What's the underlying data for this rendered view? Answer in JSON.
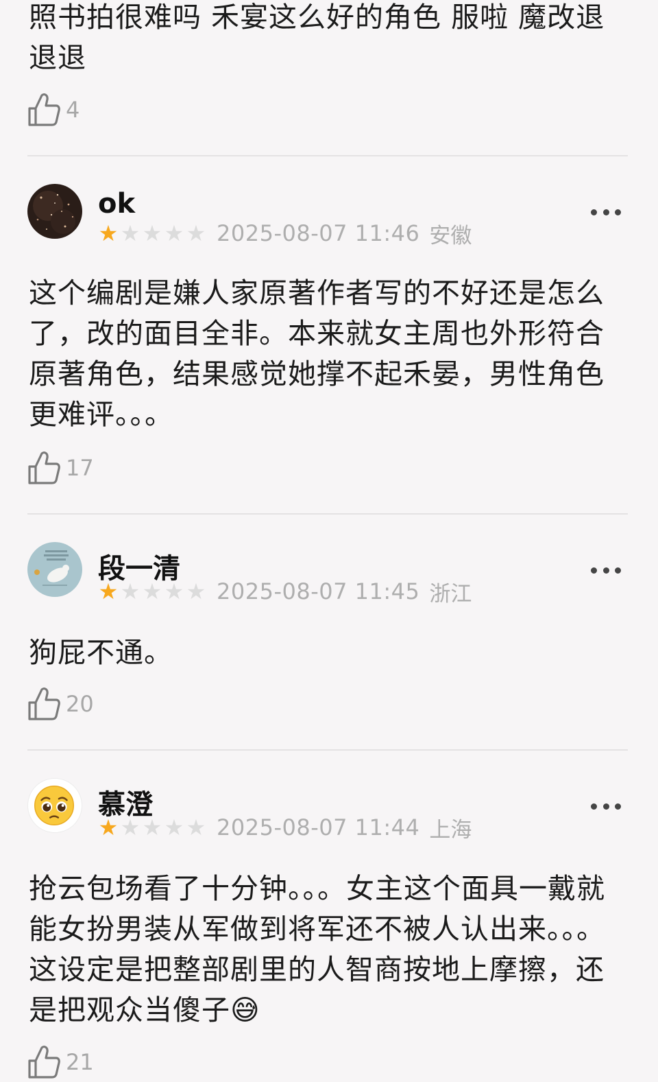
{
  "reviews": [
    {
      "text": "照书拍很难吗 禾宴这么好的角色 服啦 魔改退退退",
      "likes": "4"
    },
    {
      "user": "ok",
      "rating": 1,
      "date": "2025-08-07 11:46",
      "region": "安徽",
      "text": "这个编剧是嫌人家原著作者写的不好还是怎么了，改的面目全非。本来就女主周也外形符合原著角色，结果感觉她撑不起禾晏，男性角色更难评。。。",
      "likes": "17"
    },
    {
      "user": "段一清",
      "rating": 1,
      "date": "2025-08-07 11:45",
      "region": "浙江",
      "text": "狗屁不通。",
      "likes": "20"
    },
    {
      "user": "慕澄",
      "rating": 1,
      "date": "2025-08-07 11:44",
      "region": "上海",
      "text": "抢云包场看了十分钟。。。女主这个面具一戴就能女扮男装从军做到将军还不被人认出来。。。这设定是把整部剧里的人智商按地上摩擦，还是把观众当傻子😅",
      "likes": "21"
    }
  ],
  "icons": {
    "like": "thumbs-up-outline-icon",
    "more": "more-horizontal-icon",
    "star": "star-icon"
  },
  "colors": {
    "background": "#f7f5f6",
    "star_on": "#f7a81e",
    "star_off": "#dcdcdc",
    "meta": "#aeaeae"
  }
}
